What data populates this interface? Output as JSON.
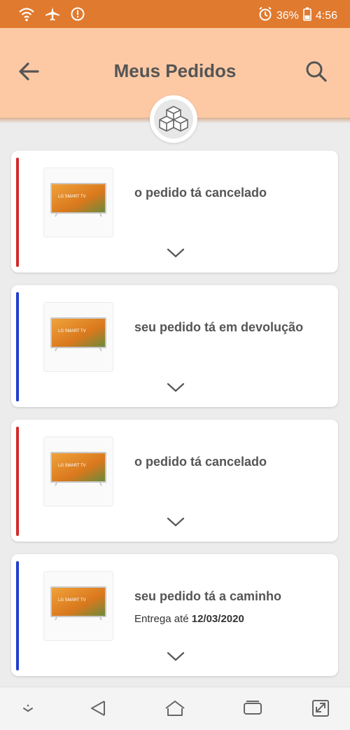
{
  "status_bar": {
    "battery": "36%",
    "time": "4:56",
    "icons": [
      "wifi-icon",
      "airplane-icon",
      "alert-icon",
      "alarm-icon",
      "battery-icon"
    ],
    "background": "#e07a2f"
  },
  "header": {
    "title": "Meus Pedidos",
    "back_icon": "arrow-left-icon",
    "search_icon": "search-icon",
    "badge_icon": "boxes-icon",
    "background": "#fcc9a4"
  },
  "orders": [
    {
      "status": "o pedido tá cancelado",
      "stripe_color": "#d42a2a",
      "product_label": "LG SMART TV"
    },
    {
      "status": "seu pedido tá em devolução",
      "stripe_color": "#1f3fcc",
      "product_label": "LG SMART TV"
    },
    {
      "status": "o pedido tá cancelado",
      "stripe_color": "#d42a2a",
      "product_label": "LG SMART TV"
    },
    {
      "status": "seu pedido tá a caminho",
      "stripe_color": "#1f3fcc",
      "product_label": "LG SMART TV",
      "delivery_prefix": "Entrega até",
      "delivery_date": "12/03/2020"
    }
  ],
  "nav_bar": {
    "icons": [
      "collapse-icon",
      "back-triangle-icon",
      "home-icon",
      "recents-icon",
      "expand-icon"
    ]
  }
}
